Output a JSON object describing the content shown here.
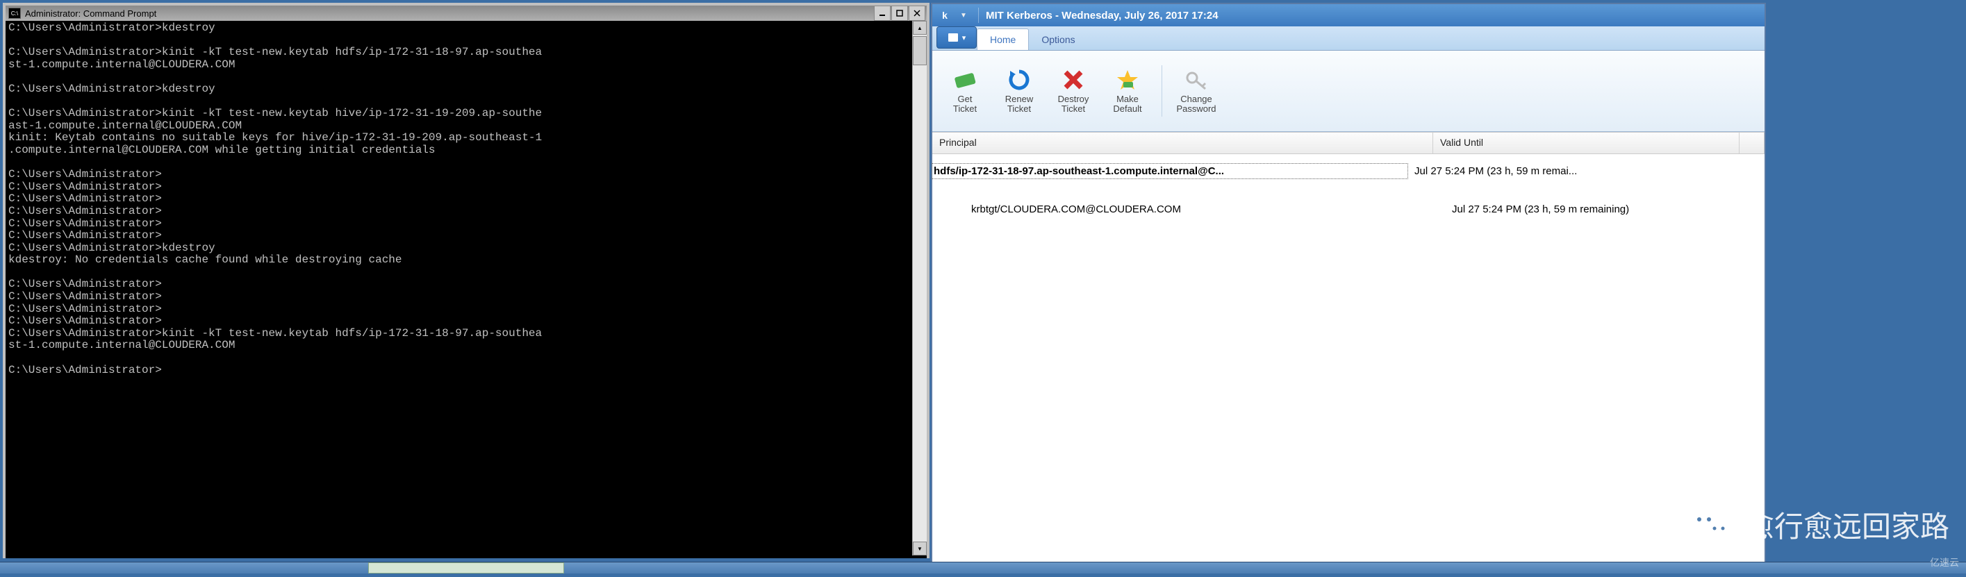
{
  "cmd": {
    "title": "Administrator: Command Prompt",
    "icon_text": "C:\\",
    "lines": "C:\\Users\\Administrator>kdestroy\n\nC:\\Users\\Administrator>kinit -kT test-new.keytab hdfs/ip-172-31-18-97.ap-southea\nst-1.compute.internal@CLOUDERA.COM\n\nC:\\Users\\Administrator>kdestroy\n\nC:\\Users\\Administrator>kinit -kT test-new.keytab hive/ip-172-31-19-209.ap-southe\nast-1.compute.internal@CLOUDERA.COM\nkinit: Keytab contains no suitable keys for hive/ip-172-31-19-209.ap-southeast-1\n.compute.internal@CLOUDERA.COM while getting initial credentials\n\nC:\\Users\\Administrator>\nC:\\Users\\Administrator>\nC:\\Users\\Administrator>\nC:\\Users\\Administrator>\nC:\\Users\\Administrator>\nC:\\Users\\Administrator>\nC:\\Users\\Administrator>kdestroy\nkdestroy: No credentials cache found while destroying cache\n\nC:\\Users\\Administrator>\nC:\\Users\\Administrator>\nC:\\Users\\Administrator>\nC:\\Users\\Administrator>\nC:\\Users\\Administrator>kinit -kT test-new.keytab hdfs/ip-172-31-18-97.ap-southea\nst-1.compute.internal@CLOUDERA.COM\n\nC:\\Users\\Administrator>"
  },
  "krb": {
    "title": "MIT Kerberos - Wednesday, July 26, 2017  17:24",
    "tabs": {
      "home": "Home",
      "options": "Options"
    },
    "toolbar": {
      "get_ticket": {
        "label1": "Get",
        "label2": "Ticket"
      },
      "renew_ticket": {
        "label1": "Renew",
        "label2": "Ticket"
      },
      "destroy_ticket": {
        "label1": "Destroy",
        "label2": "Ticket"
      },
      "make_default": {
        "label1": "Make",
        "label2": "Default"
      },
      "change_password": {
        "label1": "Change",
        "label2": "Password"
      }
    },
    "columns": {
      "principal": "Principal",
      "valid_until": "Valid Until"
    },
    "rows": [
      {
        "principal": "hdfs/ip-172-31-18-97.ap-southeast-1.compute.internal@C...",
        "valid": "Jul 27  5:24 PM (23 h, 59 m remai...",
        "selected": true
      },
      {
        "principal": "krbtgt/CLOUDERA.COM@CLOUDERA.COM",
        "valid": "Jul 27  5:24 PM (23 h, 59 m remaining)",
        "selected": false
      }
    ]
  },
  "watermark": {
    "text": "愈行愈远回家路",
    "small": "亿速云"
  }
}
